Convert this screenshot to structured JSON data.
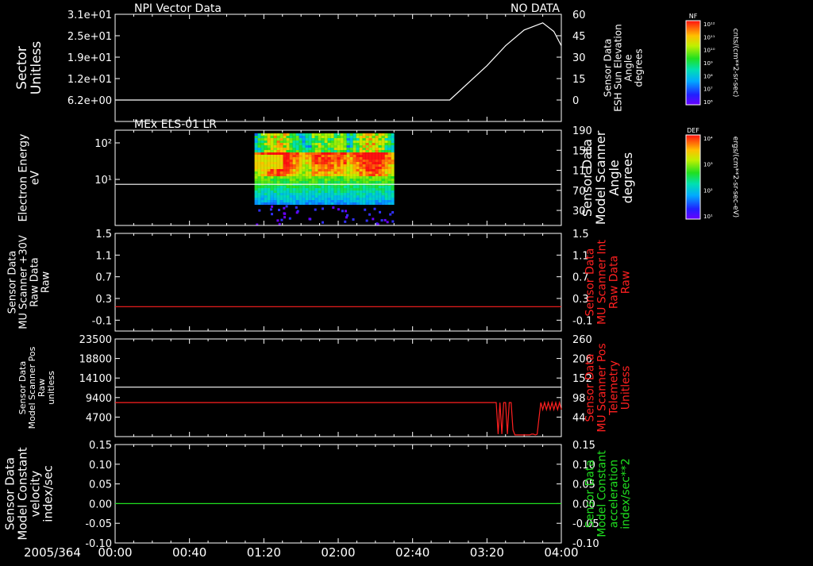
{
  "date_label": "2005/364",
  "time_ticks": [
    "00:00",
    "00:40",
    "01:20",
    "02:00",
    "02:40",
    "03:20",
    "04:00"
  ],
  "colorbars": [
    {
      "title": "NF",
      "ticks": [
        "10¹²",
        "10¹¹",
        "10¹⁰",
        "10⁹",
        "10⁸",
        "10⁷",
        "10⁶"
      ],
      "unit": "cnts/(cm**2-sr-sec)"
    },
    {
      "title": "DEF",
      "ticks": [
        "10⁴",
        "10³",
        "10²",
        "10¹"
      ],
      "unit": "ergs/(cm**2-sr-sec-eV)"
    }
  ],
  "colors": {
    "white": "#ffffff",
    "red": "#ff2020",
    "green": "#20e020"
  },
  "chart_data": [
    {
      "type": "line",
      "title_left": "NPI Vector Data",
      "title_right": "NO DATA",
      "ylabel_left": [
        "Sector",
        "Unitless"
      ],
      "ylabel_right": [
        "Sensor Data",
        "ESH Sun Elevation",
        "Angle",
        "degrees"
      ],
      "yticks_left": [
        "3.1e+01",
        "2.5e+01",
        "1.9e+01",
        "1.2e+01",
        "6.2e+00"
      ],
      "yticks_right": [
        "60",
        "45",
        "30",
        "15",
        "0"
      ],
      "ylim_right": [
        -15,
        60
      ],
      "series": [
        {
          "color": "white",
          "axis": "right",
          "x": [
            0,
            180,
            200,
            210,
            220,
            230,
            236,
            240
          ],
          "y": [
            0,
            0,
            24,
            38,
            49,
            54,
            48,
            38
          ]
        }
      ]
    },
    {
      "type": "heatmap",
      "title_left": "MEx ELS-01 LR",
      "ylabel_left": [
        "Electron Energy",
        "eV"
      ],
      "ylabel_right": [
        "Sensor Data",
        "Model Scanner",
        "Angle",
        "degrees"
      ],
      "yticks_left": [
        "10²",
        "10¹"
      ],
      "yticks_right": [
        "190",
        "150",
        "110",
        "70",
        "30"
      ],
      "ylim_right": [
        0,
        190
      ],
      "data_xrange": [
        75,
        150
      ],
      "series": [
        {
          "color": "white",
          "axis": "right",
          "x": [
            0,
            240
          ],
          "y": [
            82,
            82
          ]
        }
      ]
    },
    {
      "type": "line",
      "ylabel_left": [
        "Sensor Data",
        "MU Scanner +30V",
        "Raw Data",
        "Raw"
      ],
      "ylabel_right": [
        "Sensor Data",
        "MU Scanner Int",
        "Raw Data",
        "Raw"
      ],
      "yticks_left": [
        "1.5",
        "1.1",
        "0.7",
        "0.3",
        "-0.1"
      ],
      "yticks_right": [
        "1.5",
        "1.1",
        "0.7",
        "0.3",
        "-0.1"
      ],
      "ylim_left": [
        -0.3,
        1.5
      ],
      "series": [
        {
          "color": "red",
          "axis": "left",
          "x": [
            0,
            240
          ],
          "y": [
            0.15,
            0.15
          ]
        }
      ]
    },
    {
      "type": "line",
      "ylabel_left": [
        "Sensor Data",
        "Model Scanner Pos",
        "Raw",
        "unitless"
      ],
      "ylabel_right": [
        "Sensor Data",
        "MU Scanner Pos",
        "Telemetry",
        "Unitless"
      ],
      "yticks_left": [
        "23500",
        "18800",
        "14100",
        "9400",
        "4700"
      ],
      "yticks_right": [
        "260",
        "206",
        "152",
        "98",
        "44"
      ],
      "ylim_left": [
        0,
        23500
      ],
      "series": [
        {
          "color": "white",
          "axis": "left",
          "x": [
            0,
            240
          ],
          "y": [
            11900,
            11900
          ]
        },
        {
          "color": "red",
          "axis": "left",
          "x": [
            0,
            205,
            206,
            207,
            208,
            209,
            210,
            211,
            212,
            213,
            214,
            215,
            216,
            217,
            218,
            219,
            220,
            221,
            222,
            223,
            224,
            225,
            226,
            227,
            228,
            229,
            230,
            231,
            232,
            233,
            234,
            235,
            236,
            237,
            238,
            239,
            240
          ],
          "y": [
            8200,
            8200,
            600,
            8200,
            600,
            8200,
            8200,
            600,
            8200,
            8200,
            1600,
            400,
            400,
            400,
            400,
            400,
            400,
            400,
            400,
            400,
            600,
            600,
            400,
            600,
            4500,
            8200,
            6500,
            8200,
            6500,
            8200,
            6500,
            8200,
            6500,
            8200,
            6500,
            8200,
            6500
          ]
        }
      ]
    },
    {
      "type": "line",
      "ylabel_left": [
        "Sensor Data",
        "Model Constant",
        "velocity",
        "index/sec"
      ],
      "ylabel_right": [
        "Sensor Data",
        "Model Constant",
        "acceleration",
        "index/sec**2"
      ],
      "yticks_left": [
        "0.15",
        "0.10",
        "0.05",
        "0.00",
        "-0.05",
        "-0.10"
      ],
      "yticks_right": [
        "0.15",
        "0.10",
        "0.05",
        "0.00",
        "-0.05",
        "-0.10"
      ],
      "ylim_left": [
        -0.1,
        0.15
      ],
      "series": [
        {
          "color": "green",
          "axis": "left",
          "x": [
            0,
            240
          ],
          "y": [
            0,
            0
          ]
        }
      ]
    }
  ]
}
